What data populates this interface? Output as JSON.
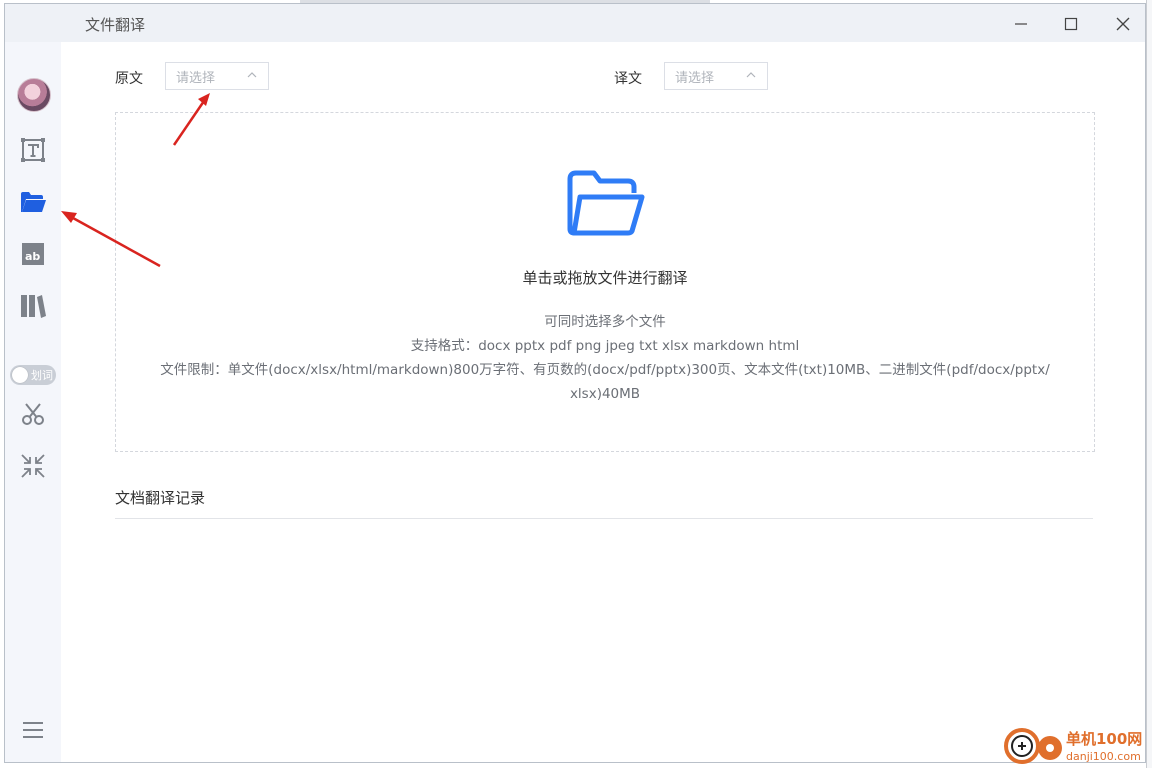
{
  "window": {
    "title": "文件翻译"
  },
  "sidebar": {
    "items": [
      {
        "name": "text-translate",
        "icon": "text-box-icon"
      },
      {
        "name": "file-translate",
        "icon": "folder-icon",
        "active": true
      },
      {
        "name": "image-translate",
        "icon": "ab-image-icon"
      },
      {
        "name": "library",
        "icon": "books-icon"
      }
    ],
    "toggle_label": "划词",
    "tools": [
      {
        "name": "screenshot",
        "icon": "scissors-icon"
      },
      {
        "name": "collapse",
        "icon": "collapse-arrows-icon"
      }
    ],
    "menu_icon": "menu-icon"
  },
  "source": {
    "label": "原文",
    "placeholder": "请选择"
  },
  "target": {
    "label": "译文",
    "placeholder": "请选择"
  },
  "dropzone": {
    "main_text": "单击或拖放文件进行翻译",
    "multi_text": "可同时选择多个文件",
    "formats_text": "支持格式：docx pptx pdf png jpeg txt xlsx markdown html",
    "limits_text": "文件限制：单文件(docx/xlsx/html/markdown)800万字符、有页数的(docx/pdf/pptx)300页、文本文件(txt)10MB、二进制文件(pdf/docx/pptx/",
    "limits_text_2": "xlsx)40MB"
  },
  "history": {
    "title": "文档翻译记录"
  },
  "watermark": {
    "name": "单机100网",
    "url": "danji100.com"
  },
  "colors": {
    "accent": "#2f7cf6",
    "arrow": "#d9241f",
    "watermark": "#e06f2c"
  }
}
